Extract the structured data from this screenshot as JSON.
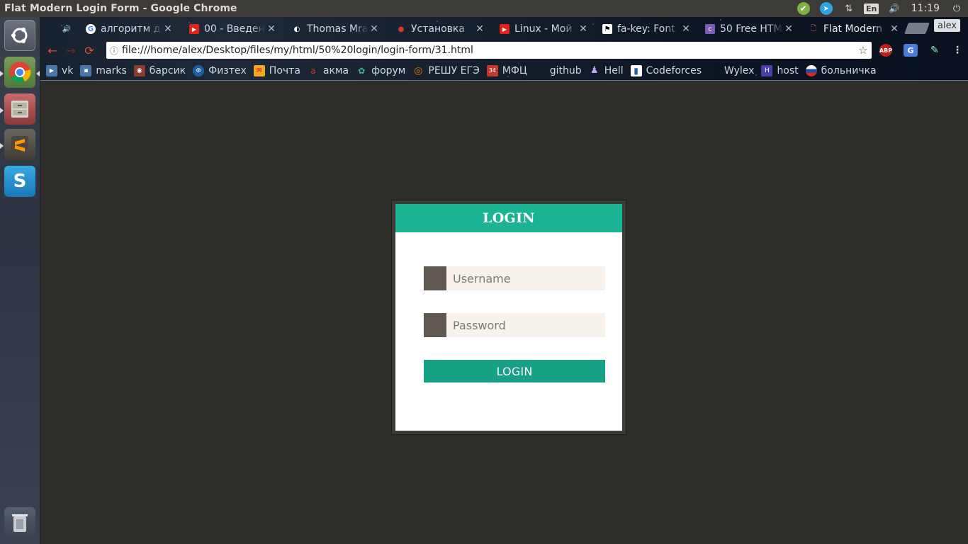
{
  "window": {
    "title": "Flat Modern Login Form - Google Chrome"
  },
  "tray": {
    "lang": "En",
    "time": "11:19",
    "check": "✔",
    "telegram": "➤",
    "arrows": "⇅",
    "volume": "🔊",
    "power": "⏻"
  },
  "browser": {
    "profile": "alex",
    "tabs": [
      {
        "title": "",
        "fav_color": "#cfd6e0",
        "fav": "🔊"
      },
      {
        "title": "алгоритм д",
        "fav_color": "#ffffff",
        "fav": "G"
      },
      {
        "title": "00 - Введени",
        "fav_color": "#e62117",
        "fav": "▶"
      },
      {
        "title": "Thomas Mra",
        "fav_color": "#222222",
        "fav": "◐"
      },
      {
        "title": "Установка",
        "fav_color": "#d33",
        "fav": "●"
      },
      {
        "title": "Linux - Мой",
        "fav_color": "#e62117",
        "fav": "▶"
      },
      {
        "title": "fa-key: Font",
        "fav_color": "#ffffff",
        "fav": "⚑"
      },
      {
        "title": "50 Free HTM",
        "fav_color": "#7a5bb5",
        "fav": "c"
      },
      {
        "title": "Flat Modern",
        "fav_color": "#0d1624",
        "fav": "🗋"
      }
    ],
    "address": {
      "url": "file:///home/alex/Desktop/files/my/html/50%20login/login-form/31.html",
      "info": "ⓘ",
      "star": "☆"
    },
    "nav": {
      "back": "←",
      "forward": "→",
      "reload": "⟳"
    },
    "extensions": [
      "ABP",
      "G"
    ],
    "bookmarks": [
      {
        "label": "vk",
        "color": "#4a76a8",
        "fav": "▶"
      },
      {
        "label": "marks",
        "color": "#4a76a8",
        "fav": "▪"
      },
      {
        "label": "барсик",
        "color": "#8b3a2b",
        "fav": "◉"
      },
      {
        "label": "Физтех",
        "color": "#1f5fa8",
        "fav": "⊛"
      },
      {
        "label": "Почта",
        "color": "#f5a623",
        "fav": "✉"
      },
      {
        "label": "акма",
        "color": "#c0392b",
        "fav": "a"
      },
      {
        "label": "форум",
        "color": "#2a7b6f",
        "fav": "✿"
      },
      {
        "label": "РЕШУ ЕГЭ",
        "color": "#e07b00",
        "fav": "◎"
      },
      {
        "label": "МФЦ",
        "color": "#c0392b",
        "fav": "34"
      },
      {
        "label": "github",
        "color": "#0d1624",
        "fav": ""
      },
      {
        "label": "Hell",
        "color": "#6b4ea8",
        "fav": "♟"
      },
      {
        "label": "Codeforces",
        "color": "#ffffff",
        "fav": "▮"
      },
      {
        "label": "Wylex",
        "color": "#0d1624",
        "fav": ""
      },
      {
        "label": "host",
        "color": "#4a3ea8",
        "fav": "H"
      },
      {
        "label": "больничка",
        "color": "#1a4fa8",
        "fav": "●"
      }
    ]
  },
  "login": {
    "header": "LOGIN",
    "username_placeholder": "Username",
    "password_placeholder": "Password",
    "button": "LOGIN"
  },
  "colors": {
    "accent": "#1ab394",
    "button": "#16a085",
    "page_bg": "#2f2d29",
    "input_bg": "#f7f3ec",
    "icon_bg": "#5e5851"
  }
}
